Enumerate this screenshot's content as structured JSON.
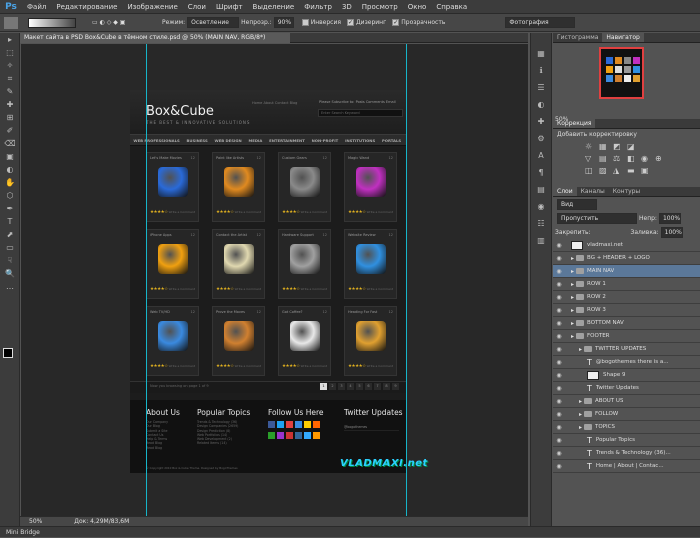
{
  "menu": [
    "Файл",
    "Редактирование",
    "Изображение",
    "Слои",
    "Шрифт",
    "Выделение",
    "Фильтр",
    "3D",
    "Просмотр",
    "Окно",
    "Справка"
  ],
  "app_logo": "Ps",
  "options": {
    "mode_label": "Режим:",
    "mode_value": "Осветление",
    "opacity_label": "Непрозр.:",
    "opacity_value": "90%",
    "inverse": "Инверсия",
    "dither": "Дизеринг",
    "transparency": "Прозрачность",
    "workspace": "Фотография"
  },
  "doc_tab": "Макет сайта в PSD Box&Cube в тёмном стиле.psd @ 50% (MAIN NAV, RGB/8*)",
  "design": {
    "logo": "Box&Cube",
    "tagline": "THE BEST & INNOVATIVE SOLUTIONS",
    "toplinks": "Home    About    Contact    Blog",
    "subscribe": "Please Subscribe to: Posts  Comments  Email",
    "search_placeholder": "Enter Search Keyword",
    "nav": [
      "WEB PROFESSIONALS",
      "BUSINESS",
      "WEB DESIGN",
      "MEDIA",
      "ENTERTAINMENT",
      "NON-PROFIT",
      "INSTITUTIONS",
      "PORTALS"
    ],
    "cards": [
      {
        "title": "Let's Make Movies",
        "num": "12",
        "color": "#2a6ad8"
      },
      {
        "title": "Paint like Artists",
        "num": "12",
        "color": "#e08a20"
      },
      {
        "title": "Custom Gears",
        "num": "12",
        "color": "#8a8a8a"
      },
      {
        "title": "Magic Wand",
        "num": "12",
        "color": "#c030c0"
      },
      {
        "title": "iPhone Apps",
        "num": "12",
        "color": "#f0a010"
      },
      {
        "title": "Contact the Artist",
        "num": "12",
        "color": "#e0d8b0"
      },
      {
        "title": "Hardware Support",
        "num": "12",
        "color": "#a0a0a0"
      },
      {
        "title": "Website Review",
        "num": "12",
        "color": "#3090e0"
      },
      {
        "title": "Web TV/HD",
        "num": "12",
        "color": "#3a8ae0"
      },
      {
        "title": "Prove the Moves",
        "num": "12",
        "color": "#d08030"
      },
      {
        "title": "Got Coffee?",
        "num": "12",
        "color": "#e8e8e8"
      },
      {
        "title": "Heading For Fast",
        "num": "12",
        "color": "#e0a030"
      }
    ],
    "card_more": "Write a Comment",
    "pager_text": "Now you browsing on page 1 of 9",
    "pages": [
      "1",
      "2",
      "3",
      "4",
      "5",
      "6",
      "7",
      "8",
      "9"
    ],
    "footer": {
      "about_h": "About Us",
      "about_links": [
        "Our Company",
        "Our Blog",
        "Submit a Site",
        "Contact Us",
        "Help & Terms",
        "Read Blog",
        "Read Blog"
      ],
      "topics_h": "Popular Topics",
      "topics": [
        "Trends & Technology (36)",
        "Design Companies (2659)",
        "Design Prediction (8)",
        "Web Portfolios (14)",
        "Web Development (2)",
        "Related Items (14)"
      ],
      "follow_h": "Follow Us Here",
      "twitter_h": "Twitter Updates",
      "twitter_handle": "@bogothemes",
      "copyright": "© Copyright 2010 Box & Cube Theme. Designed by BogoThemes"
    },
    "watermark": "VLADMAXI.net"
  },
  "status": {
    "zoom": "50%",
    "doc": "Док: 4,29M/83,6M"
  },
  "bottom_label": "Mini Bridge",
  "panels": {
    "top_tabs": [
      "Гистограмма",
      "Навигатор"
    ],
    "nav_zoom": "50%",
    "adj_tab": "Коррекция",
    "adj_label": "Добавить корректировку",
    "layer_tabs": [
      "Слои",
      "Каналы",
      "Контуры"
    ],
    "kind": "Вид",
    "blend": "Пропустить",
    "opacity_label": "Непр:",
    "opacity": "100%",
    "lock_label": "Закрепить:",
    "fill_label": "Заливка:",
    "fill": "100%",
    "layers": [
      {
        "name": "vladmaxi.net",
        "type": "thumb"
      },
      {
        "name": "BG + HEADER + LOGO",
        "type": "folder"
      },
      {
        "name": "MAIN NAV",
        "type": "folder",
        "sel": true
      },
      {
        "name": "ROW 1",
        "type": "folder"
      },
      {
        "name": "ROW 2",
        "type": "folder"
      },
      {
        "name": "ROW 3",
        "type": "folder"
      },
      {
        "name": "BOTTOM NAV",
        "type": "folder"
      },
      {
        "name": "FOOTER",
        "type": "folder"
      },
      {
        "name": "TWITTER UPDATES",
        "type": "folder",
        "indent": 1
      },
      {
        "name": "@bogothemes there is a...",
        "type": "text",
        "indent": 2
      },
      {
        "name": "Shape 9",
        "type": "thumb",
        "indent": 2
      },
      {
        "name": "Twitter Updates",
        "type": "text",
        "indent": 2
      },
      {
        "name": "ABOUT US",
        "type": "folder",
        "indent": 1
      },
      {
        "name": "FOLLOW",
        "type": "folder",
        "indent": 1
      },
      {
        "name": "TOPICS",
        "type": "folder",
        "indent": 1
      },
      {
        "name": "Popular Topics",
        "type": "text",
        "indent": 2
      },
      {
        "name": "Trends & Technology (36)...",
        "type": "text",
        "indent": 2
      },
      {
        "name": "Home  |  About  |  Contac...",
        "type": "text",
        "indent": 2
      }
    ]
  }
}
